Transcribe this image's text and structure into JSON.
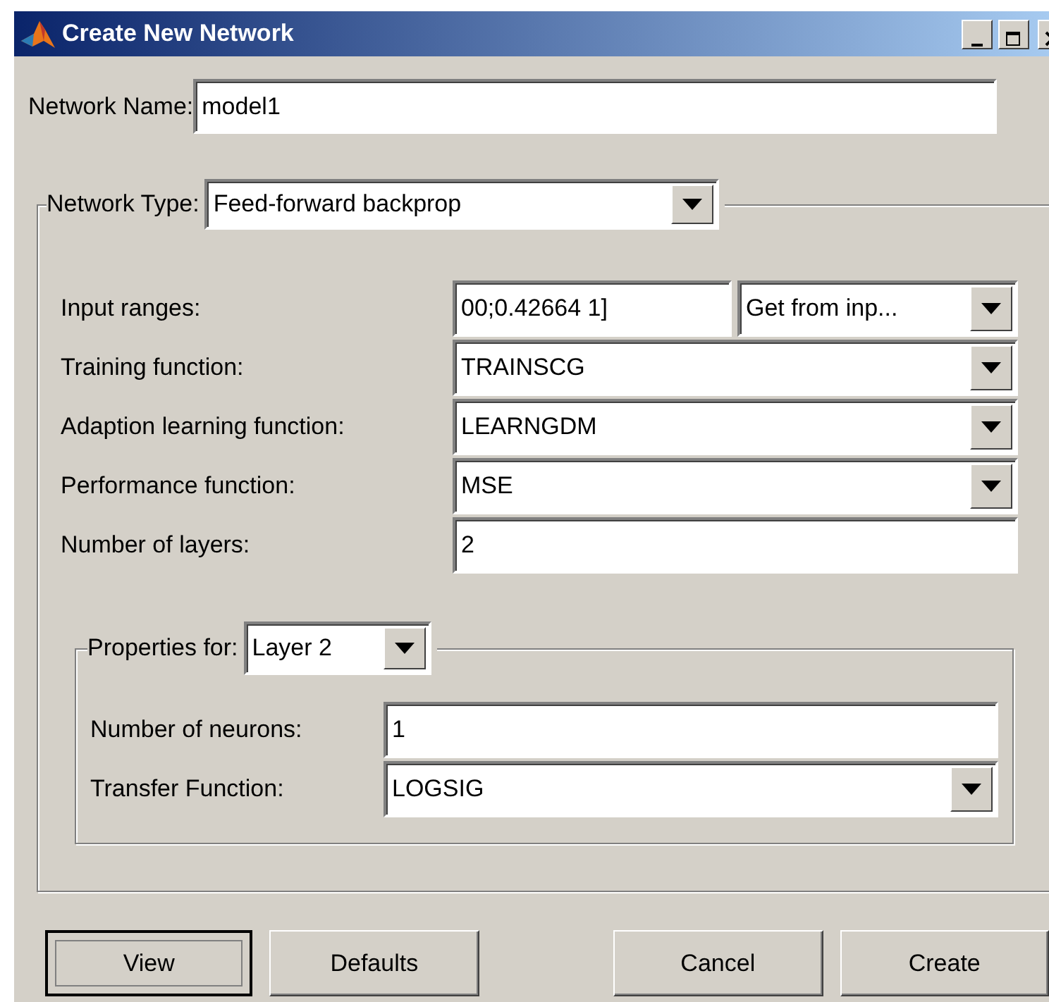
{
  "window": {
    "title": "Create New Network"
  },
  "network_name": {
    "label": "Network Name:",
    "value": "model1"
  },
  "network_type": {
    "label": "Network Type:",
    "value": "Feed-forward backprop"
  },
  "fields": [
    {
      "kind": "range",
      "label": "Input ranges:",
      "value": "00;0.42664 1]",
      "option": "Get from inp..."
    },
    {
      "kind": "select",
      "label": "Training function:",
      "value": "TRAINSCG"
    },
    {
      "kind": "select",
      "label": "Adaption learning function:",
      "value": "LEARNGDM"
    },
    {
      "kind": "select",
      "label": "Performance function:",
      "value": "MSE"
    },
    {
      "kind": "text",
      "label": "Number of layers:",
      "value": "2"
    }
  ],
  "properties": {
    "label": "Properties for:",
    "value": "Layer 2",
    "fields": [
      {
        "kind": "text",
        "label": "Number of neurons:",
        "value": "1"
      },
      {
        "kind": "select",
        "label": "Transfer Function:",
        "value": "LOGSIG"
      }
    ]
  },
  "buttons": [
    {
      "label": "View",
      "default": true
    },
    {
      "label": "Defaults",
      "default": false
    },
    {
      "label": "Cancel",
      "default": false
    },
    {
      "label": "Create",
      "default": false
    }
  ]
}
